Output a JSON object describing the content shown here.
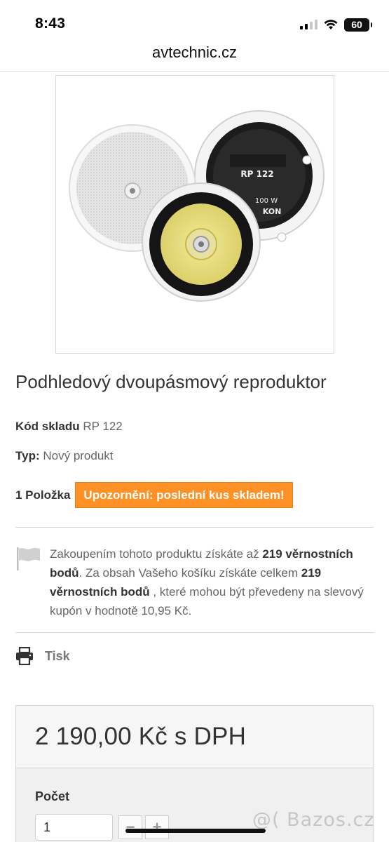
{
  "status_bar": {
    "time": "8:43",
    "battery": "60"
  },
  "browser": {
    "url": "avtechnic.cz"
  },
  "product": {
    "image_labels": {
      "model": "RP 122",
      "power": "100 W",
      "brand": "KON"
    },
    "title": "Podhledový dvoupásmový reproduktor",
    "sku_label": "Kód skladu",
    "sku_value": "RP 122",
    "type_label": "Typ:",
    "type_value": "Nový produkt",
    "quantity_label": "1 Položka",
    "stock_warning": "Upozornění: poslední kus skladem!"
  },
  "loyalty": {
    "part1": "Zakoupením tohoto produktu získáte až ",
    "points1": "219 věrnostních bodů",
    "part2": ". Za obsah Vašeho košíku získáte celkem ",
    "points2": "219 věrnostních bodů",
    "part3": " , které mohou být převedeny na slevový kupón v hodnotě 10,95 Kč."
  },
  "print": {
    "label": "Tisk"
  },
  "purchase": {
    "price": "2 190,00 Kč s DPH",
    "quantity_title": "Počet",
    "quantity_value": "1",
    "minus": "−",
    "plus": "+"
  },
  "watermark": "@( Bazos.cz"
}
